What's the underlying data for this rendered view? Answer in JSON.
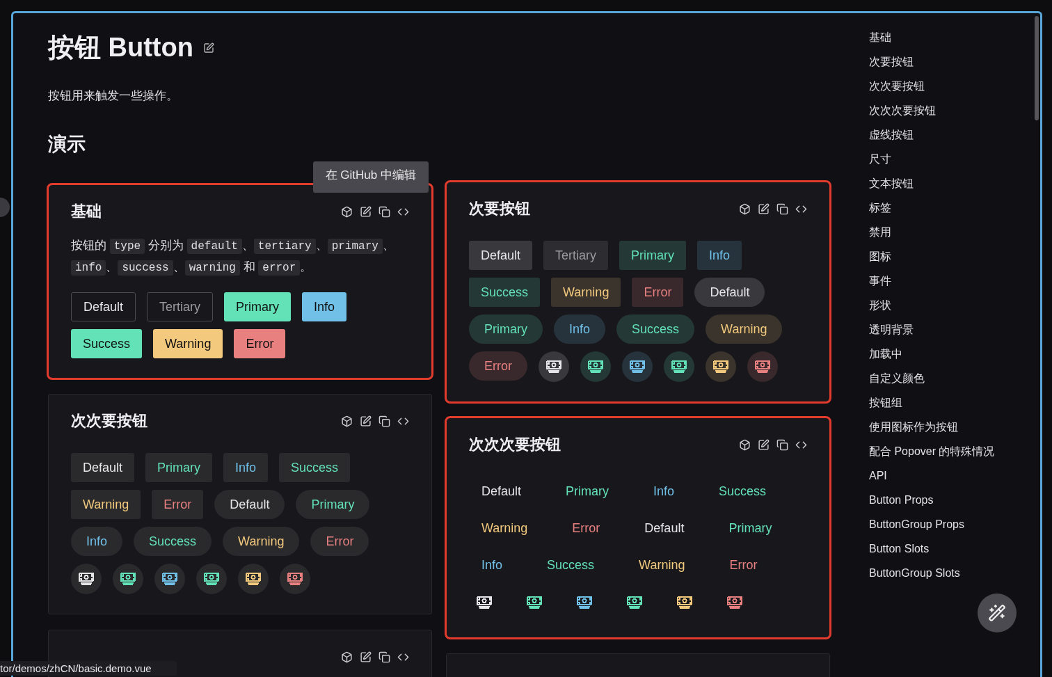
{
  "page": {
    "title": "按钮 Button",
    "description": "按钮用来触发一些操作。",
    "section": "演示"
  },
  "columns": [
    [
      {
        "kind": "solid",
        "title": "基础",
        "highlighted": true,
        "tooltip": {
          "text": "在 GitHub 中编辑"
        },
        "description": [
          {
            "kind": "text",
            "text": "按钮的 "
          },
          {
            "kind": "code",
            "text": "type"
          },
          {
            "kind": "text",
            "text": " 分别为 "
          },
          {
            "kind": "code",
            "text": "default"
          },
          {
            "kind": "text",
            "text": "、"
          },
          {
            "kind": "code",
            "text": "tertiary"
          },
          {
            "kind": "text",
            "text": "、"
          },
          {
            "kind": "code",
            "text": "primary"
          },
          {
            "kind": "text",
            "text": "、"
          },
          {
            "kind": "code",
            "text": "info"
          },
          {
            "kind": "text",
            "text": "、"
          },
          {
            "kind": "code",
            "text": "success"
          },
          {
            "kind": "text",
            "text": "、"
          },
          {
            "kind": "code",
            "text": "warning"
          },
          {
            "kind": "text",
            "text": " 和 "
          },
          {
            "kind": "code",
            "text": "error"
          },
          {
            "kind": "text",
            "text": "。"
          }
        ],
        "buttons": [
          {
            "kind": "outline",
            "label": "Default",
            "color": "#e6e6e8"
          },
          {
            "kind": "outline",
            "label": "Tertiary",
            "color": "#9a9aa0"
          },
          {
            "kind": "fill",
            "label": "Primary",
            "color": "#63e2b7"
          },
          {
            "kind": "fill",
            "label": "Info",
            "color": "#70c0e8"
          },
          {
            "kind": "fill",
            "label": "Success",
            "color": "#63e2b7"
          },
          {
            "kind": "fill",
            "label": "Warning",
            "color": "#f2c97d"
          },
          {
            "kind": "fill",
            "label": "Error",
            "color": "#e88080"
          }
        ]
      },
      {
        "kind": "tertiary",
        "title": "次次要按钮",
        "highlighted": false,
        "buttons": [
          {
            "kind": "text",
            "label": "Default",
            "color": "#e6e6e8",
            "round": false
          },
          {
            "kind": "text",
            "label": "Primary",
            "color": "#63e2b7",
            "round": false
          },
          {
            "kind": "text",
            "label": "Info",
            "color": "#70c0e8",
            "round": false
          },
          {
            "kind": "text",
            "label": "Success",
            "color": "#63e2b7",
            "round": false
          },
          {
            "kind": "text",
            "label": "Warning",
            "color": "#f2c97d",
            "round": false
          },
          {
            "kind": "text",
            "label": "Error",
            "color": "#e88080",
            "round": false
          },
          {
            "kind": "text",
            "label": "Default",
            "color": "#e6e6e8",
            "round": true
          },
          {
            "kind": "text",
            "label": "Primary",
            "color": "#63e2b7",
            "round": true
          },
          {
            "kind": "text",
            "label": "Info",
            "color": "#70c0e8",
            "round": true
          },
          {
            "kind": "text",
            "label": "Success",
            "color": "#63e2b7",
            "round": true
          },
          {
            "kind": "text",
            "label": "Warning",
            "color": "#f2c97d",
            "round": true
          },
          {
            "kind": "text",
            "label": "Error",
            "color": "#e88080",
            "round": true
          },
          {
            "kind": "icon",
            "color": "#e6e6e8"
          },
          {
            "kind": "icon",
            "color": "#63e2b7"
          },
          {
            "kind": "icon",
            "color": "#70c0e8"
          },
          {
            "kind": "icon",
            "color": "#63e2b7"
          },
          {
            "kind": "icon",
            "color": "#f2c97d"
          },
          {
            "kind": "icon",
            "color": "#e88080"
          }
        ]
      },
      {
        "kind": "cut",
        "highlighted": false
      }
    ],
    [
      {
        "kind": "secondary",
        "title": "次要按钮",
        "highlighted": true,
        "buttons": [
          {
            "kind": "text",
            "label": "Default",
            "color": "#e6e6e8",
            "round": false
          },
          {
            "kind": "text",
            "label": "Tertiary",
            "color": "#9a9aa0",
            "round": false
          },
          {
            "kind": "text",
            "label": "Primary",
            "color": "#63e2b7",
            "round": false
          },
          {
            "kind": "text",
            "label": "Info",
            "color": "#70c0e8",
            "round": false
          },
          {
            "kind": "text",
            "label": "Success",
            "color": "#63e2b7",
            "round": false
          },
          {
            "kind": "text",
            "label": "Warning",
            "color": "#f2c97d",
            "round": false
          },
          {
            "kind": "text",
            "label": "Error",
            "color": "#e88080",
            "round": false
          },
          {
            "kind": "text",
            "label": "Default",
            "color": "#e6e6e8",
            "round": true
          },
          {
            "kind": "text",
            "label": "Primary",
            "color": "#63e2b7",
            "round": true
          },
          {
            "kind": "text",
            "label": "Info",
            "color": "#70c0e8",
            "round": true
          },
          {
            "kind": "text",
            "label": "Success",
            "color": "#63e2b7",
            "round": true
          },
          {
            "kind": "text",
            "label": "Warning",
            "color": "#f2c97d",
            "round": true
          },
          {
            "kind": "text",
            "label": "Error",
            "color": "#e88080",
            "round": true
          },
          {
            "kind": "icon",
            "color": "#e6e6e8"
          },
          {
            "kind": "icon",
            "color": "#63e2b7"
          },
          {
            "kind": "icon",
            "color": "#70c0e8"
          },
          {
            "kind": "icon",
            "color": "#63e2b7"
          },
          {
            "kind": "icon",
            "color": "#f2c97d"
          },
          {
            "kind": "icon",
            "color": "#e88080"
          }
        ]
      },
      {
        "kind": "quaternary",
        "title": "次次次要按钮",
        "highlighted": true,
        "buttons": [
          {
            "kind": "text",
            "label": "Default",
            "color": "#e6e6e8"
          },
          {
            "kind": "text",
            "label": "Primary",
            "color": "#63e2b7"
          },
          {
            "kind": "text",
            "label": "Info",
            "color": "#70c0e8"
          },
          {
            "kind": "text",
            "label": "Success",
            "color": "#63e2b7"
          },
          {
            "kind": "text",
            "label": "Warning",
            "color": "#f2c97d"
          },
          {
            "kind": "text",
            "label": "Error",
            "color": "#e88080"
          },
          {
            "kind": "text",
            "label": "Default",
            "color": "#e6e6e8"
          },
          {
            "kind": "text",
            "label": "Primary",
            "color": "#63e2b7"
          },
          {
            "kind": "text",
            "label": "Info",
            "color": "#70c0e8"
          },
          {
            "kind": "text",
            "label": "Success",
            "color": "#63e2b7"
          },
          {
            "kind": "text",
            "label": "Warning",
            "color": "#f2c97d"
          },
          {
            "kind": "text",
            "label": "Error",
            "color": "#e88080"
          },
          {
            "kind": "icon",
            "color": "#e6e6e8"
          },
          {
            "kind": "icon",
            "color": "#63e2b7"
          },
          {
            "kind": "icon",
            "color": "#70c0e8"
          },
          {
            "kind": "icon",
            "color": "#63e2b7"
          },
          {
            "kind": "icon",
            "color": "#f2c97d"
          },
          {
            "kind": "icon",
            "color": "#e88080"
          }
        ]
      },
      {
        "kind": "blank",
        "highlighted": false
      }
    ]
  ],
  "nav": [
    "基础",
    "次要按钮",
    "次次要按钮",
    "次次次要按钮",
    "虚线按钮",
    "尺寸",
    "文本按钮",
    "标签",
    "禁用",
    "图标",
    "事件",
    "形状",
    "透明背景",
    "加载中",
    "自定义颜色",
    "按钮组",
    "使用图标作为按钮",
    "配合 Popover 的特殊情况",
    "API",
    "Button Props",
    "ButtonGroup Props",
    "Button Slots",
    "ButtonGroup Slots"
  ],
  "status_bar": {
    "url": "tor/demos/zhCN/basic.demo.vue"
  }
}
